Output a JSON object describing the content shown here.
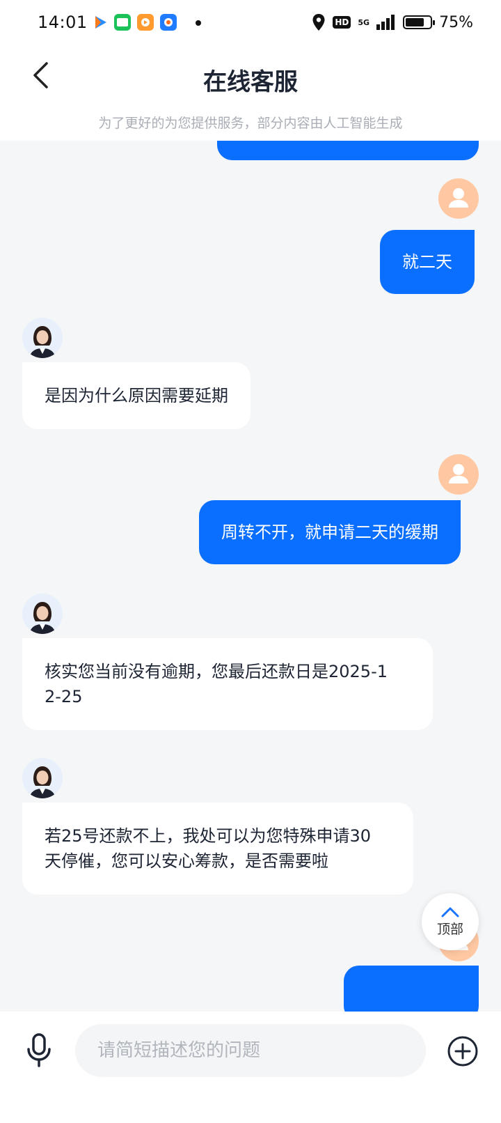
{
  "status_bar": {
    "time": "14:01",
    "network": "5G",
    "hd_label": "HD",
    "battery_percent": "75%",
    "battery_level": 0.75,
    "icons": [
      "play-app-icon",
      "iqiyi-app-icon",
      "video-app-icon",
      "camera-app-icon",
      "location-icon",
      "signal-icon"
    ]
  },
  "header": {
    "title": "在线客服",
    "subtitle": "为了更好的为您提供服务，部分内容由人工智能生成"
  },
  "messages": [
    {
      "sender": "user",
      "text": "就二天"
    },
    {
      "sender": "agent",
      "text": "是因为什么原因需要延期"
    },
    {
      "sender": "user",
      "text": "周转不开，就申请二天的缓期"
    },
    {
      "sender": "agent",
      "text_lines": [
        "核实您当前没有逾期，您最后还款日是2025-1",
        "2-25"
      ]
    },
    {
      "sender": "agent",
      "text_lines": [
        "若25号还款不上，我处可以为您特殊申请30",
        "天停催，您可以安心筹款，是否需要啦"
      ]
    }
  ],
  "scroll_top_button": {
    "label": "顶部"
  },
  "input_bar": {
    "placeholder": "请简短描述您的问题"
  },
  "colors": {
    "user_bubble": "#0a6fff",
    "agent_bubble": "#ffffff",
    "user_avatar": "#ffc8a3",
    "background": "#f5f6f8"
  }
}
